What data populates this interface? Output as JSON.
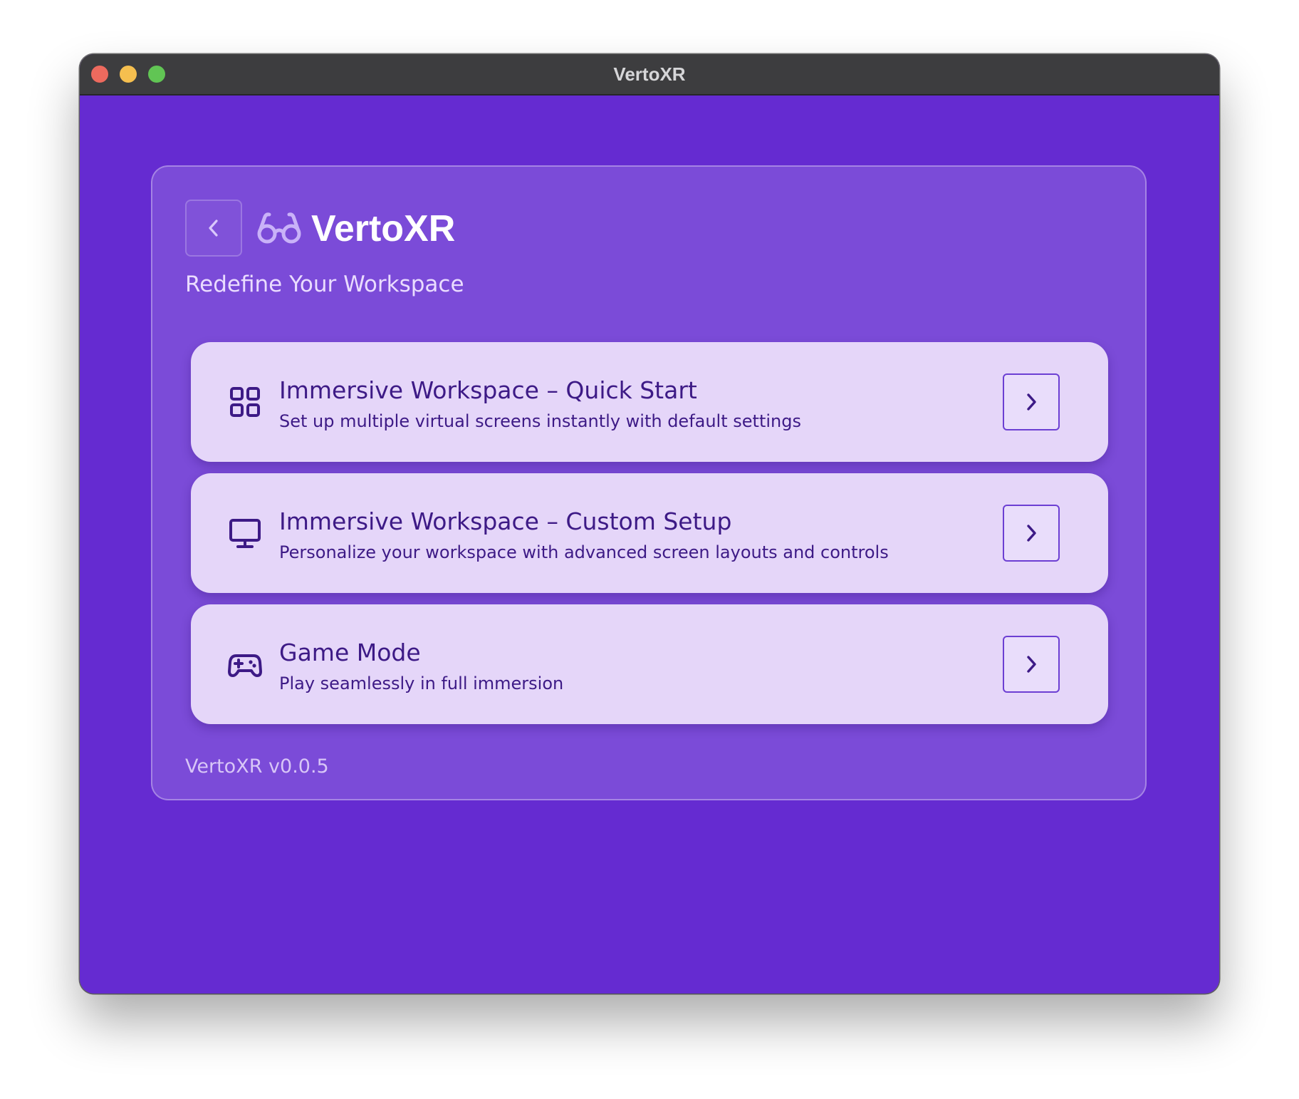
{
  "window": {
    "title": "VertoXR",
    "background": "#652bd1",
    "titlebar_color": "#3d3d3f"
  },
  "header": {
    "brand_icon": "glasses-icon",
    "brand_name": "VertoXR",
    "tagline": "Redefine Your Workspace",
    "back_icon": "chevron-left-icon"
  },
  "options": [
    {
      "icon": "grid-icon",
      "title": "Immersive Workspace – Quick Start",
      "description": "Set up multiple virtual screens instantly with default settings",
      "action_icon": "chevron-right-icon"
    },
    {
      "icon": "monitor-icon",
      "title": "Immersive Workspace – Custom Setup",
      "description": "Personalize your workspace with advanced screen layouts and controls",
      "action_icon": "chevron-right-icon"
    },
    {
      "icon": "gamepad-icon",
      "title": "Game Mode",
      "description": "Play seamlessly in full immersion",
      "action_icon": "chevron-right-icon"
    }
  ],
  "footer": {
    "version": "VertoXR v0.0.5"
  },
  "colors": {
    "card": "#7b4bd8",
    "option_card": "#e5d6f9",
    "option_text": "#3d1a86",
    "accent_border": "#6c3fd3"
  }
}
